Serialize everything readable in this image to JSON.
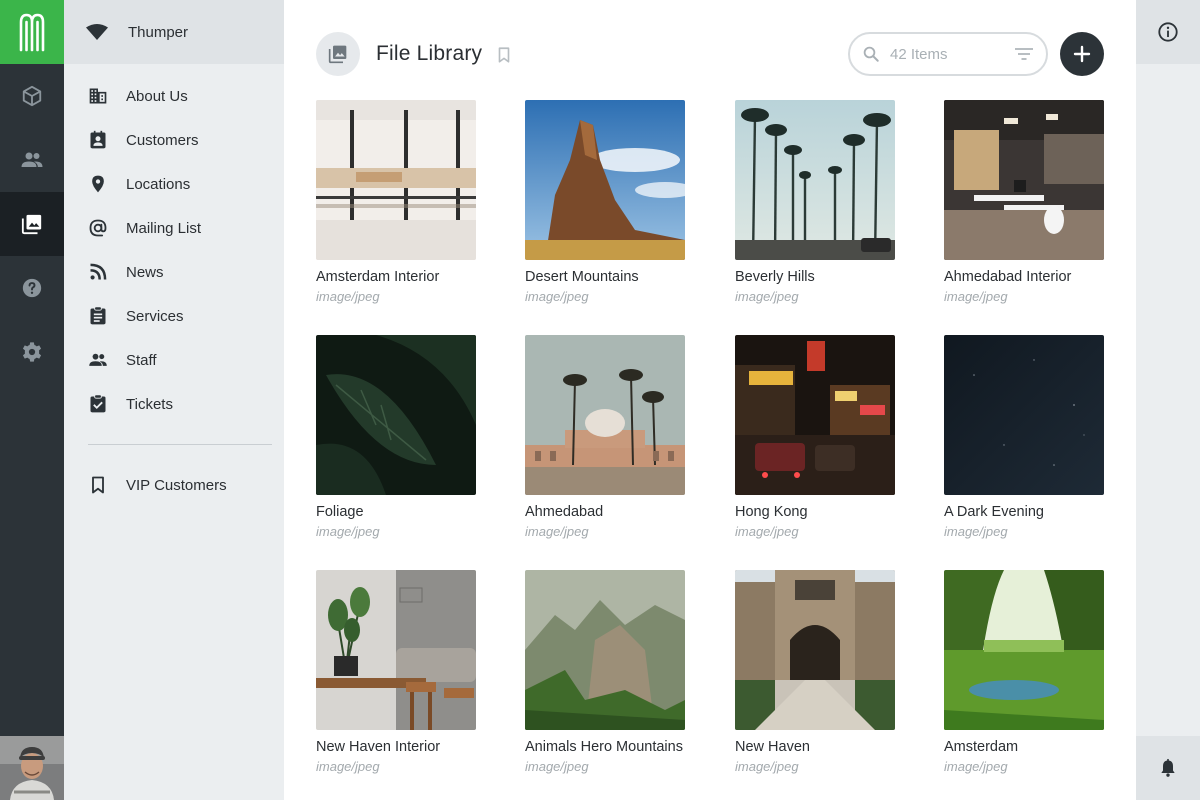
{
  "colors": {
    "brand_green": "#3bb54a",
    "rail_dark": "#2c3338",
    "rail_active": "#1b2024",
    "sidebar_bg": "#ebeef0",
    "muted_text": "#a3a9ad"
  },
  "rail": {
    "items": [
      {
        "icon": "cube-icon",
        "label": "Products"
      },
      {
        "icon": "people-icon",
        "label": "Contacts"
      },
      {
        "icon": "photo-library-icon",
        "label": "File Library",
        "active": true
      },
      {
        "icon": "help-icon",
        "label": "Help"
      },
      {
        "icon": "gear-icon",
        "label": "Settings"
      }
    ]
  },
  "sidebar": {
    "account": "Thumper",
    "items": [
      {
        "label": "About Us",
        "icon": "building-icon"
      },
      {
        "label": "Customers",
        "icon": "contact-card-icon"
      },
      {
        "label": "Locations",
        "icon": "location-pin-icon"
      },
      {
        "label": "Mailing List",
        "icon": "at-sign-icon"
      },
      {
        "label": "News",
        "icon": "rss-icon"
      },
      {
        "label": "Services",
        "icon": "clipboard-icon"
      },
      {
        "label": "Staff",
        "icon": "people-icon"
      },
      {
        "label": "Tickets",
        "icon": "clipboard-check-icon"
      }
    ],
    "saved": [
      {
        "label": "VIP Customers",
        "icon": "bookmark-icon"
      }
    ]
  },
  "header": {
    "title": "File Library"
  },
  "search": {
    "placeholder": "42 Items"
  },
  "files": [
    {
      "name": "Amsterdam Interior",
      "type": "image/jpeg"
    },
    {
      "name": "Desert Mountains",
      "type": "image/jpeg"
    },
    {
      "name": "Beverly Hills",
      "type": "image/jpeg"
    },
    {
      "name": "Ahmedabad Interior",
      "type": "image/jpeg"
    },
    {
      "name": "Foliage",
      "type": "image/jpeg"
    },
    {
      "name": "Ahmedabad",
      "type": "image/jpeg"
    },
    {
      "name": "Hong Kong",
      "type": "image/jpeg"
    },
    {
      "name": "A Dark Evening",
      "type": "image/jpeg"
    },
    {
      "name": "New Haven Interior",
      "type": "image/jpeg"
    },
    {
      "name": "Animals Hero Mountains",
      "type": "image/jpeg"
    },
    {
      "name": "New Haven",
      "type": "image/jpeg"
    },
    {
      "name": "Amsterdam",
      "type": "image/jpeg"
    }
  ]
}
